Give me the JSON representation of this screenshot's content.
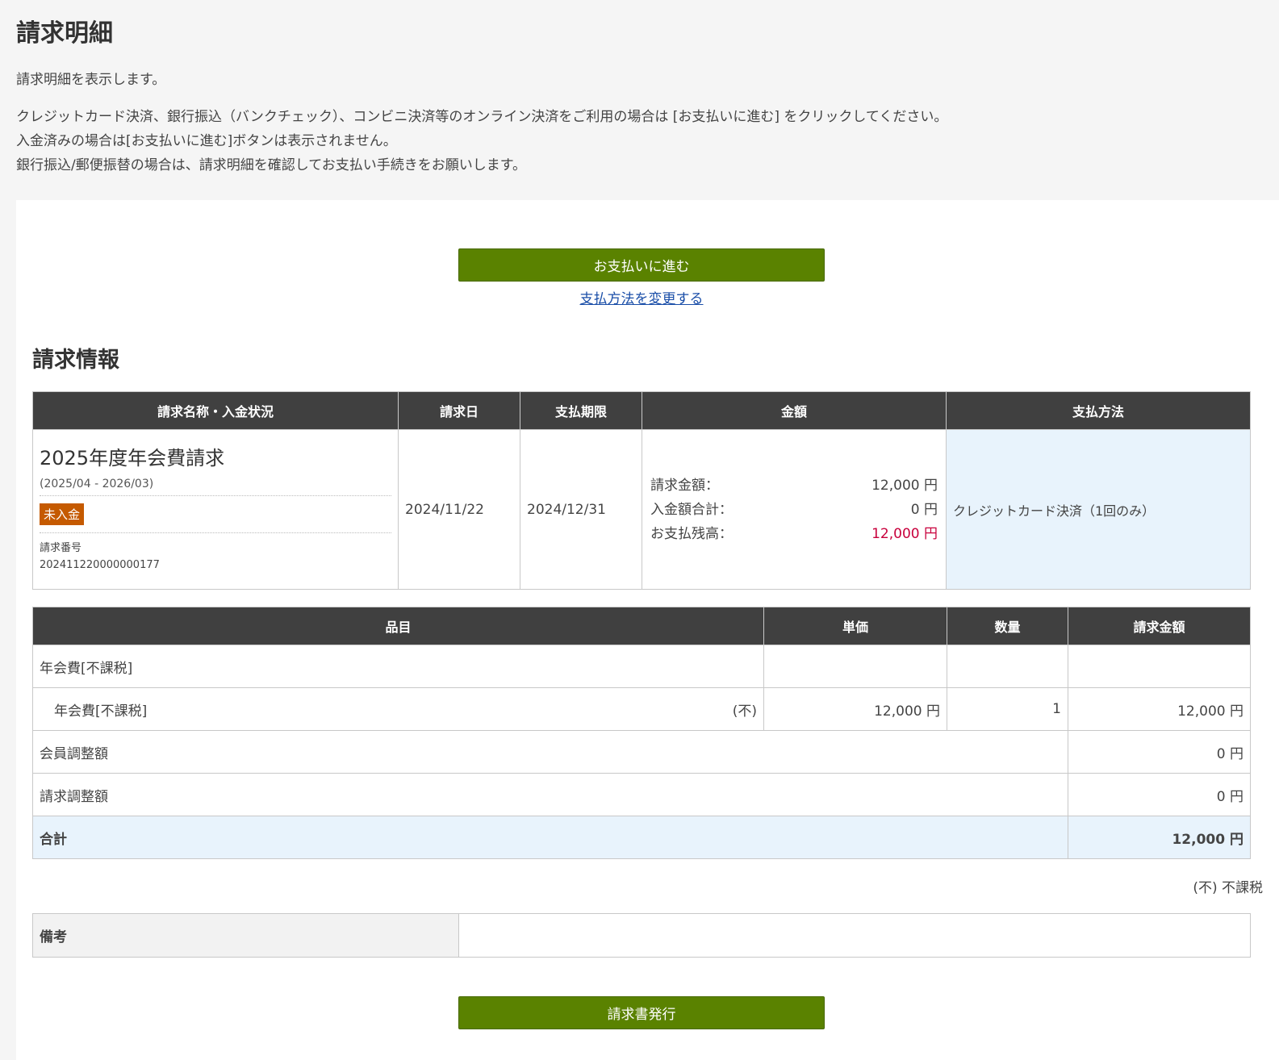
{
  "page": {
    "title": "請求明細",
    "intro": "請求明細を表示します。",
    "lines": [
      "クレジットカード決済、銀行振込（バンクチェック）、コンビニ決済等のオンライン決済をご利用の場合は [お支払いに進む] をクリックしてください。",
      "入金済みの場合は[お支払いに進む]ボタンは表示されません。",
      "銀行振込/郵便振替の場合は、請求明細を確認してお支払い手続きをお願いします。"
    ]
  },
  "actions": {
    "pay_label": "お支払いに進む",
    "change_method_label": "支払方法を変更する",
    "issue_invoice_label": "請求書発行"
  },
  "billing_info": {
    "section_title": "請求情報",
    "headers": [
      "請求名称・入金状況",
      "請求日",
      "支払期限",
      "金額",
      "支払方法"
    ],
    "name": "2025年度年会費請求",
    "period": "(2025/04 - 2026/03)",
    "status_badge": "未入金",
    "status_color": "#c55a00",
    "number_label": "請求番号",
    "number": "202411220000000177",
    "billing_date": "2024/11/22",
    "due_date": "2024/12/31",
    "amounts": [
      {
        "label": "請求金額：",
        "value": "12,000 円"
      },
      {
        "label": "入金額合計：",
        "value": "0 円"
      },
      {
        "label": "お支払残高：",
        "value": "12,000 円"
      }
    ],
    "payment_method": "クレジットカード決済（1回のみ）"
  },
  "items": {
    "headers": [
      "品目",
      "単価",
      "数量",
      "請求金額"
    ],
    "group_name": "年会費[不課税]",
    "sub_item": {
      "name": "年会費[不課税]",
      "tax_mark": "(不)",
      "unit_price": "12,000 円",
      "qty": "1",
      "amount": "12,000 円"
    },
    "adjust_member": {
      "label": "会員調整額",
      "amount": "0 円"
    },
    "adjust_bill": {
      "label": "請求調整額",
      "amount": "0 円"
    },
    "total": {
      "label": "合計",
      "amount": "12,000 円"
    },
    "tax_note": "(不) 不課税"
  },
  "remarks": {
    "label": "備考",
    "value": ""
  },
  "colors": {
    "accent_green": "#5a8200",
    "header_dark": "#404040",
    "highlight_blue": "#e8f3fc",
    "alert_red": "#c8003c"
  }
}
